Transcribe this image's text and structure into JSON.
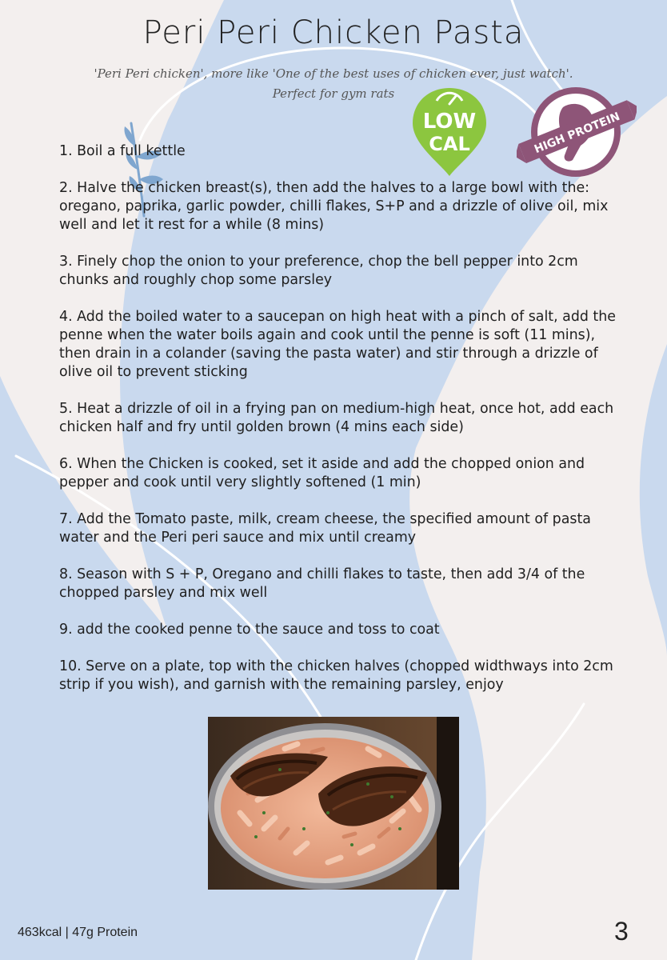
{
  "title": "Peri Peri Chicken Pasta",
  "subtitle_line1": "'Peri Peri chicken', more like 'One of the best uses of chicken ever, just watch'.",
  "subtitle_line2": "Perfect for gym rats",
  "badges": {
    "low_cal_line1": "LOW",
    "low_cal_line2": "CAL",
    "high_protein": "HIGH PROTEIN",
    "low_cal_color": "#8cc63f",
    "high_protein_color": "#8e5578"
  },
  "steps": [
    "1. Boil a full kettle",
    "2. Halve the chicken breast(s), then add the halves to a large bowl with the: oregano, paprika, garlic powder, chilli flakes, S+P and a drizzle of olive oil, mix well and let it rest for a while (8 mins)",
    "3. Finely chop the onion to your preference, chop the bell pepper into 2cm chunks and roughly chop some parsley",
    "4. Add the boiled water to a saucepan on high heat with a pinch of salt, add the penne when the water boils again and cook until the penne is soft  (11 mins), then drain in a colander (saving the pasta water) and stir through a drizzle of olive oil to prevent sticking",
    "5. Heat a drizzle of oil in a frying pan on medium-high heat, once hot, add each chicken half and fry until golden brown (4 mins each side)",
    "6. When the Chicken is cooked, set it aside and add the chopped onion and pepper and cook until very slightly softened (1 min)",
    "7. Add the Tomato paste, milk, cream cheese, the specified amount of pasta water and the Peri peri sauce and mix until creamy",
    "8. Season with S + P, Oregano and chilli flakes to taste, then add 3/4 of the chopped parsley and mix well",
    "9. add the cooked penne to the sauce and toss to coat",
    "10. Serve on a plate, top with the chicken halves (chopped widthways into 2cm strip if you wish), and garnish with the remaining parsley, enjoy"
  ],
  "footer": {
    "stats": "463kcal | 47g Protein",
    "page_number": "3"
  },
  "colors": {
    "background": "#f3efee",
    "wave_blue": "#c9d9ee",
    "leaf_blue": "#7fa6cf"
  }
}
